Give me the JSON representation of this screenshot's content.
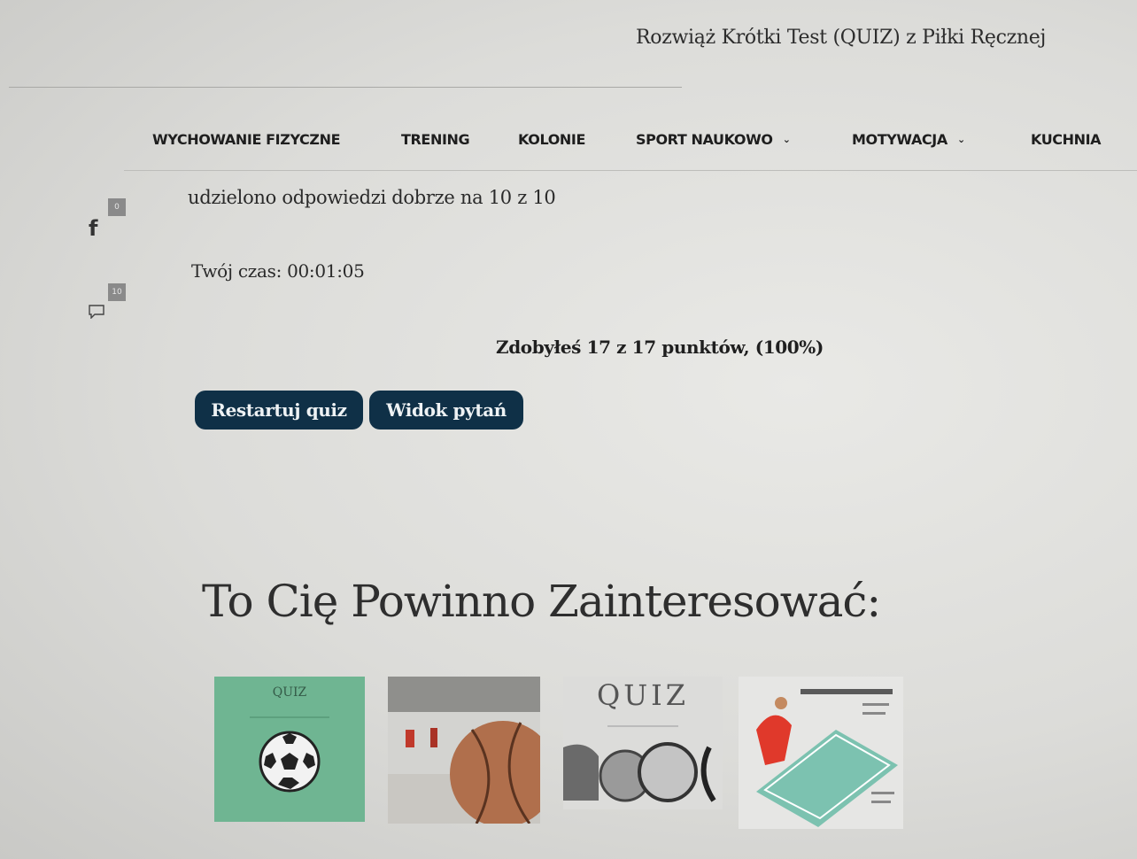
{
  "header": {
    "title": "Rozwiąż Krótki Test (QUIZ) z Piłki Ręcznej"
  },
  "nav": {
    "items": [
      {
        "label": "WYCHOWANIE FIZYCZNE",
        "has_dropdown": false
      },
      {
        "label": "TRENING",
        "has_dropdown": false
      },
      {
        "label": "KOLONIE",
        "has_dropdown": false
      },
      {
        "label": "SPORT NAUKOWO",
        "has_dropdown": true
      },
      {
        "label": "MOTYWACJA",
        "has_dropdown": true
      },
      {
        "label": "KUCHNIA",
        "has_dropdown": false
      }
    ],
    "dropdown_glyph": "⌄"
  },
  "social": {
    "facebook_icon": "f",
    "facebook_count": "0",
    "comments_count": "10"
  },
  "quiz_result": {
    "answers_text": "udzielono odpowiedzi dobrze na 10 z 10",
    "time_text": "Twój czas: 00:01:05",
    "score_text": "Zdobyłeś 17 z 17 punktów, (100%)",
    "restart_label": "Restartuj quiz",
    "view_questions_label": "Widok pytań"
  },
  "related": {
    "title": "To Cię Powinno Zainteresować:",
    "thumbnails": [
      {
        "label": "QUIZ"
      },
      {
        "label": ""
      },
      {
        "label": "QUIZ"
      },
      {
        "label": ""
      }
    ]
  },
  "colors": {
    "button_bg": "#0f3047",
    "button_text": "#eef2f4",
    "thumb_green": "#6fb592"
  }
}
